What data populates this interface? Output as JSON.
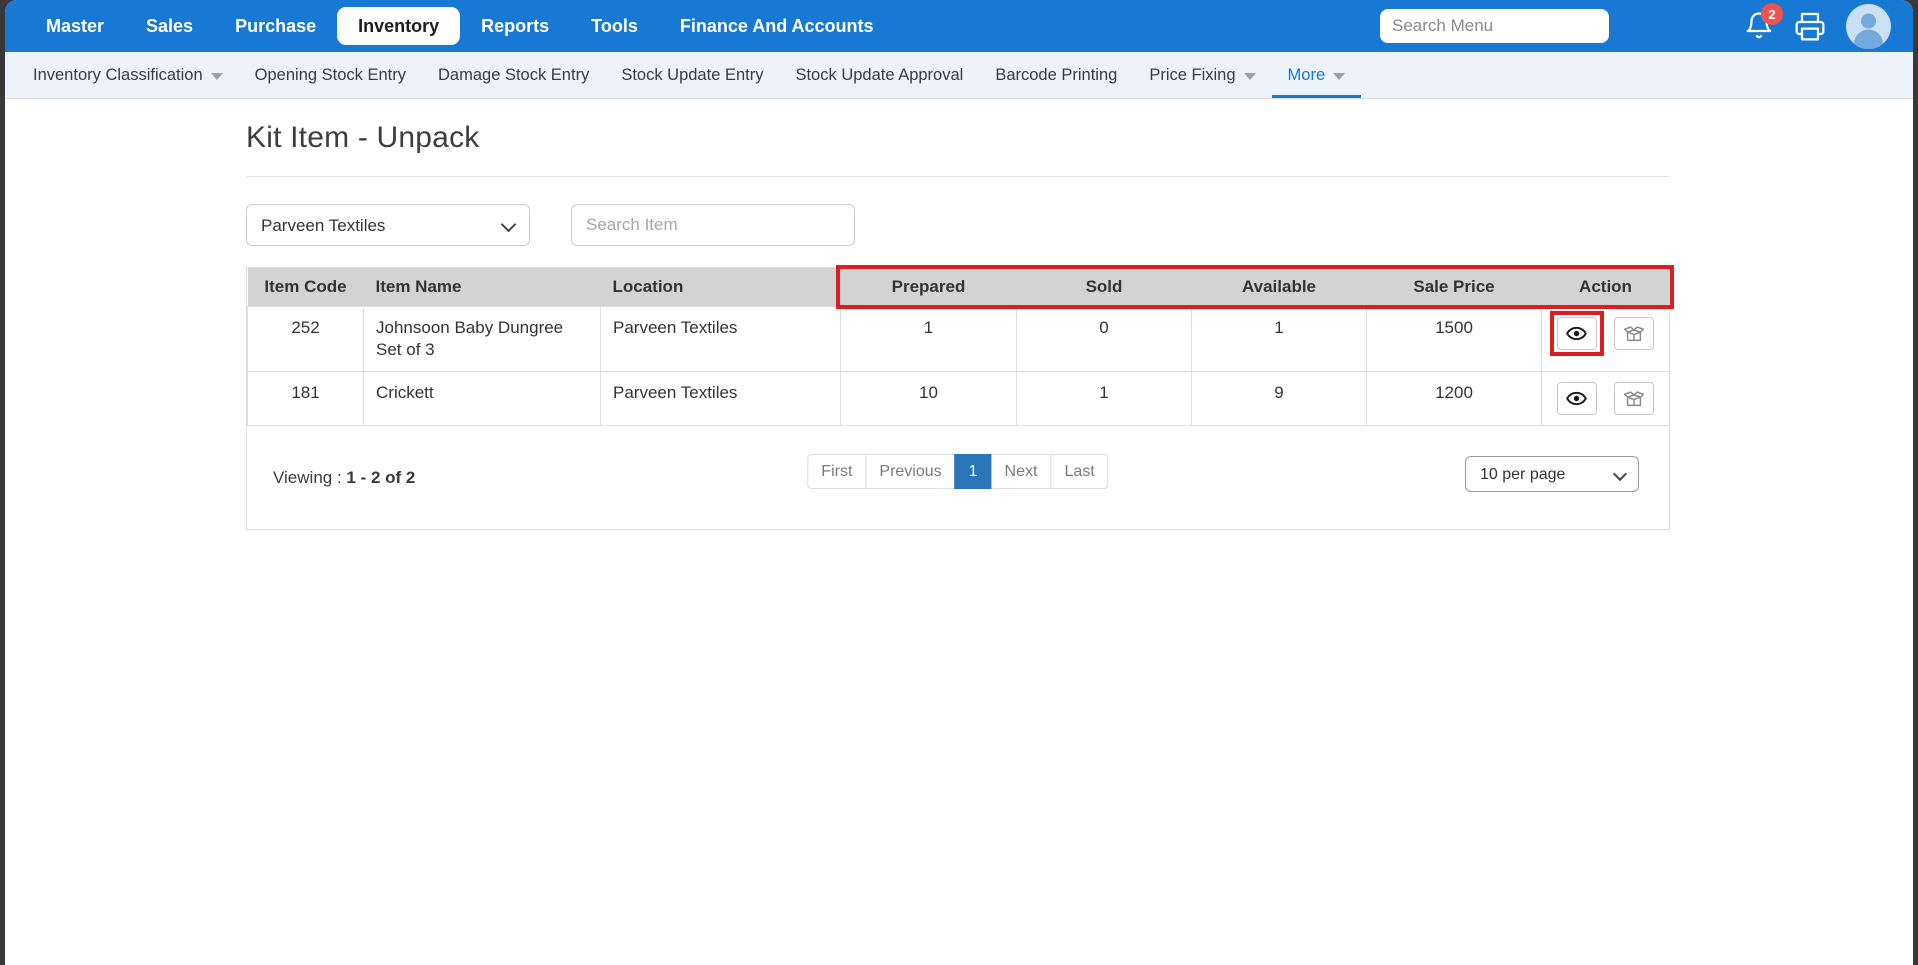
{
  "colors": {
    "primary_blue": "#1779d3",
    "subnav_bg": "#edf3fa",
    "table_header_bg": "#d3d3d3",
    "highlight_red": "#dc1e1e",
    "active_page_blue": "#2b76b9",
    "badge_red": "#ef5350"
  },
  "topnav": {
    "items": [
      "Master",
      "Sales",
      "Purchase",
      "Inventory",
      "Reports",
      "Tools",
      "Finance And Accounts"
    ],
    "active_item": "Inventory",
    "search_placeholder": "Search Menu",
    "notification_count": "2",
    "icons": [
      "bell-icon",
      "printer-icon",
      "avatar"
    ]
  },
  "subnav": {
    "items": [
      {
        "label": "Inventory Classification",
        "caret": true
      },
      {
        "label": "Opening Stock Entry"
      },
      {
        "label": "Damage Stock Entry"
      },
      {
        "label": "Stock Update Entry"
      },
      {
        "label": "Stock Update Approval"
      },
      {
        "label": "Barcode Printing"
      },
      {
        "label": "Price Fixing",
        "caret": true
      },
      {
        "label": "More",
        "caret": true,
        "active": true
      }
    ]
  },
  "page": {
    "title": "Kit Item - Unpack"
  },
  "filters": {
    "location_selected": "Parveen Textiles",
    "search_placeholder": "Search Item"
  },
  "table": {
    "columns": [
      "Item Code",
      "Item Name",
      "Location",
      "Prepared",
      "Sold",
      "Available",
      "Sale Price",
      "Action"
    ],
    "highlighted_columns": [
      "Prepared",
      "Sold",
      "Available",
      "Sale Price",
      "Action"
    ],
    "action_icons": [
      "eye-icon",
      "unpack-box-icon"
    ],
    "rows": [
      {
        "item_code": "252",
        "item_name": "Johnsoon Baby Dungree Set of 3",
        "location": "Parveen Textiles",
        "prepared": "1",
        "sold": "0",
        "available": "1",
        "sale_price": "1500",
        "eye_highlighted": true
      },
      {
        "item_code": "181",
        "item_name": "Crickett",
        "location": "Parveen Textiles",
        "prepared": "10",
        "sold": "1",
        "available": "9",
        "sale_price": "1200",
        "eye_highlighted": false
      }
    ]
  },
  "pagination": {
    "viewing_label": "Viewing :",
    "viewing_value": "1 - 2 of 2",
    "first": "First",
    "previous": "Previous",
    "current_page": "1",
    "next": "Next",
    "last": "Last",
    "per_page": "10 per page"
  }
}
